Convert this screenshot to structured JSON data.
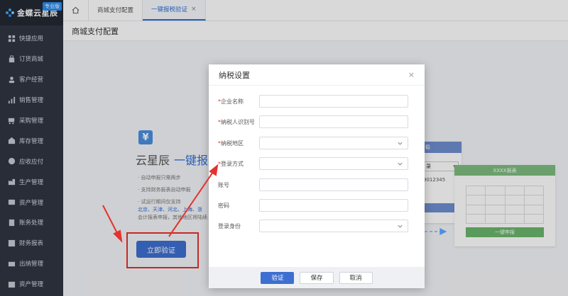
{
  "brand": {
    "name": "金蝶云星辰",
    "edition": "专业版"
  },
  "sidebar": {
    "items": [
      {
        "label": "快捷应用",
        "icon": "grid-icon"
      },
      {
        "label": "订货商城",
        "icon": "shop-icon"
      },
      {
        "label": "客户经营",
        "icon": "user-icon"
      },
      {
        "label": "销售管理",
        "icon": "chart-icon"
      },
      {
        "label": "采购管理",
        "icon": "cart-icon"
      },
      {
        "label": "库存管理",
        "icon": "warehouse-icon"
      },
      {
        "label": "应收应付",
        "icon": "money-icon"
      },
      {
        "label": "生产管理",
        "icon": "factory-icon"
      },
      {
        "label": "资产管理",
        "icon": "asset-icon"
      },
      {
        "label": "账务处理",
        "icon": "ledger-icon"
      },
      {
        "label": "财务报表",
        "icon": "report-icon"
      },
      {
        "label": "出纳管理",
        "icon": "cashier-icon"
      },
      {
        "label": "资产管理",
        "icon": "box-icon"
      }
    ]
  },
  "tabs": [
    {
      "label": "商城支付配置",
      "active": false
    },
    {
      "label": "一键报税验证",
      "active": true,
      "close": "×"
    }
  ],
  "page": {
    "title": "商城支付配置",
    "promo_icon": "¥",
    "promo_title_a": "云星辰",
    "promo_title_b": "一键报",
    "lines": [
      "· 自动申报只需两步",
      "· 支持财务报表自动申报",
      "· 试运行期间仅支持",
      "北京、天津、河北、上海、浙",
      "会计报表申报，其他地区将陆续"
    ],
    "verify_now": "立即验证"
  },
  "illustration": {
    "head_right": "XXXX报表",
    "select_text": "录",
    "phone_text": "9012345",
    "submit": "一键申报"
  },
  "modal": {
    "title": "纳税设置",
    "close": "×",
    "fields": [
      {
        "label": "企业名称",
        "required": true,
        "type": "input"
      },
      {
        "label": "纳税人识别号",
        "required": true,
        "type": "input"
      },
      {
        "label": "纳税地区",
        "required": true,
        "type": "select"
      },
      {
        "label": "登录方式",
        "required": true,
        "type": "select"
      },
      {
        "label": "账号",
        "required": false,
        "type": "input"
      },
      {
        "label": "密码",
        "required": false,
        "type": "input"
      },
      {
        "label": "登录身份",
        "required": false,
        "type": "select"
      }
    ],
    "buttons": {
      "verify": "验证",
      "save": "保存",
      "cancel": "取消"
    }
  },
  "colors": {
    "primary": "#3e6fd0",
    "sidebar": "#2f3642",
    "highlight": "#e5322d"
  }
}
